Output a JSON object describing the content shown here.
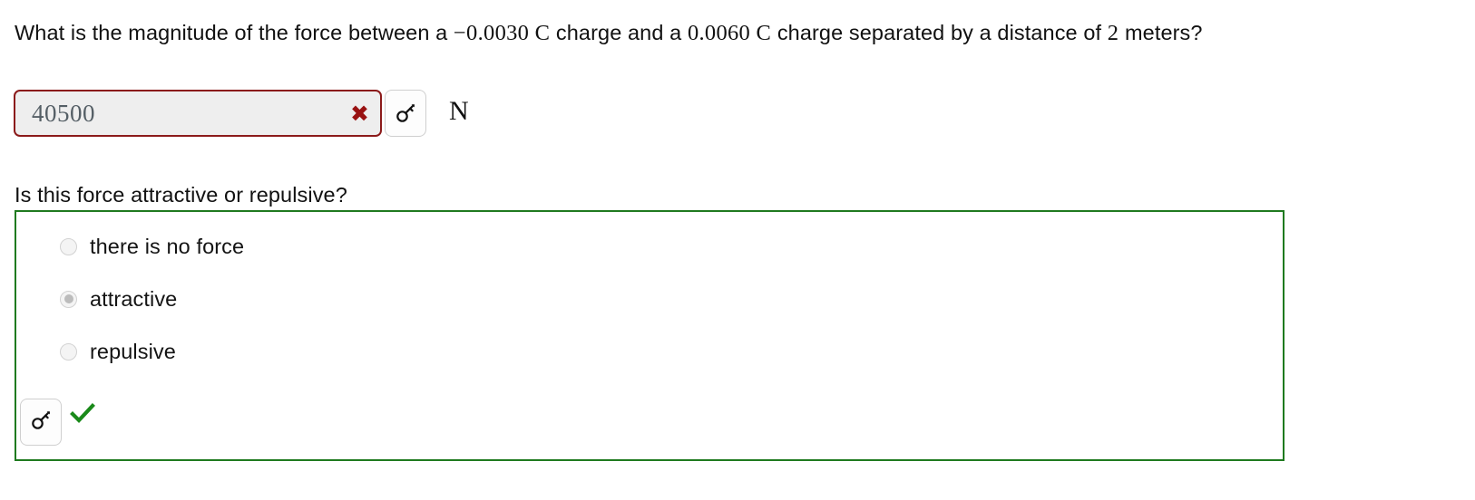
{
  "question1": {
    "text_part1": "What is the magnitude of the force between a ",
    "charge1": "−0.0030 C",
    "text_part2": " charge and a ",
    "charge2": "0.0060 C",
    "text_part3": " charge separated by a distance of ",
    "distance": "2",
    "text_part4": " meters?",
    "answer_value": "40500",
    "answer_placeholder": "",
    "status_mark": "✖",
    "status": "incorrect",
    "unit": "N",
    "key_button_label": "key-icon",
    "incorrect_color": "#8b1a1a"
  },
  "question2": {
    "text": "Is this force attractive or repulsive?",
    "options": [
      {
        "label": "there is no force",
        "selected": false
      },
      {
        "label": "attractive",
        "selected": true
      },
      {
        "label": "repulsive",
        "selected": false
      }
    ],
    "status_mark": "✔",
    "status": "correct",
    "key_button_label": "key-icon",
    "correct_color": "#1f7a1f"
  }
}
